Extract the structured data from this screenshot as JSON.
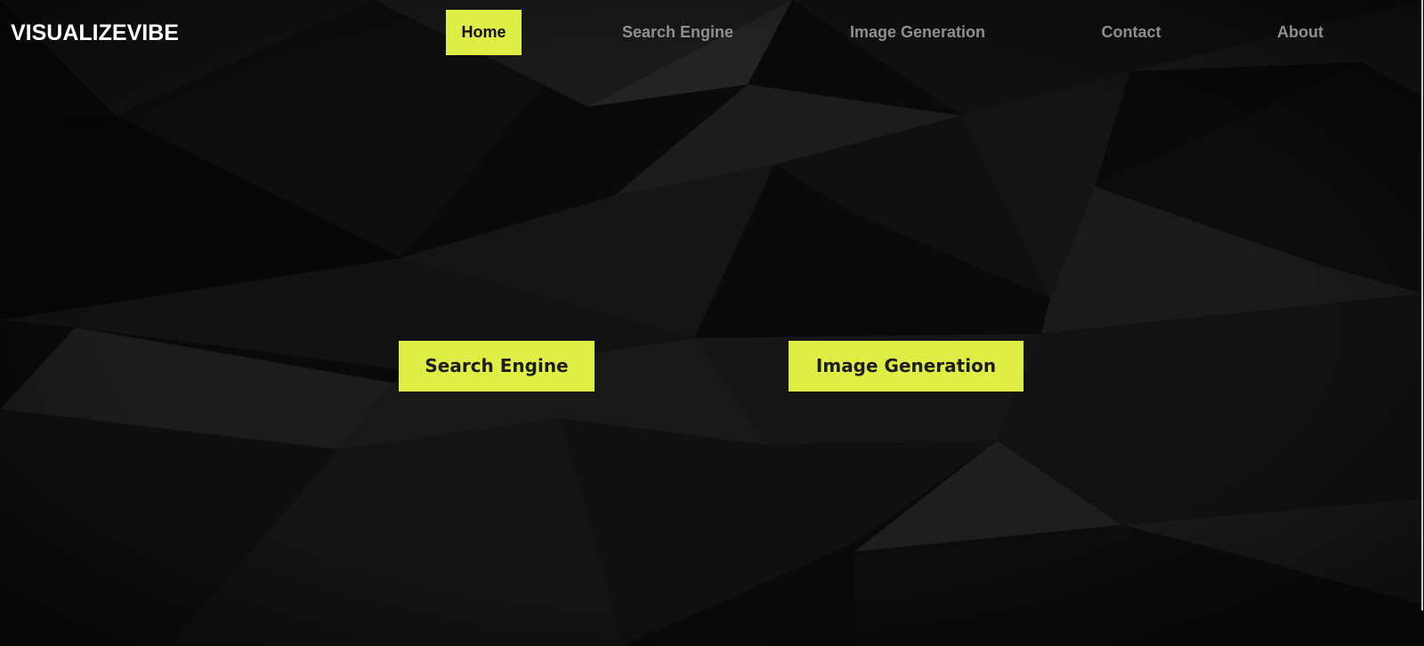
{
  "brand": {
    "name": "VISUALIZEVIBE"
  },
  "nav": {
    "items": [
      {
        "label": "Home",
        "active": true
      },
      {
        "label": "Search Engine",
        "active": false
      },
      {
        "label": "Image Generation",
        "active": false
      },
      {
        "label": "Contact",
        "active": false
      },
      {
        "label": "About",
        "active": false
      }
    ]
  },
  "hero": {
    "buttons": [
      {
        "label": "Search Engine"
      },
      {
        "label": "Image Generation"
      }
    ]
  },
  "colors": {
    "accent": "#dfee45",
    "background": "#0b0b0b",
    "nav_text": "#8f8f8f",
    "brand_text": "#ffffff"
  }
}
